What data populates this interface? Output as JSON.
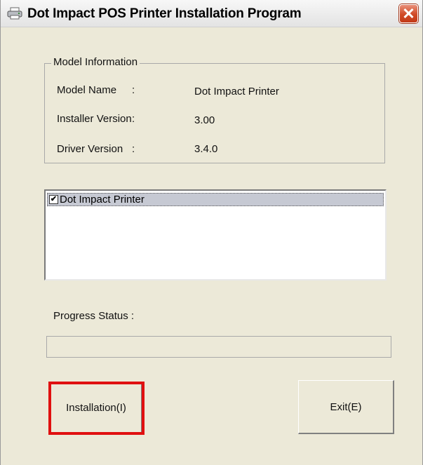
{
  "window": {
    "title": "Dot Impact POS Printer Installation Program",
    "title_icon": "printer-icon",
    "close_icon": "close-icon"
  },
  "model_info": {
    "legend": "Model Information",
    "rows": [
      {
        "label": "Model Name",
        "sep": ":",
        "value": "Dot Impact Printer"
      },
      {
        "label": "Installer Version",
        "sep": ":",
        "value": "3.00"
      },
      {
        "label": "Driver Version",
        "sep": ":",
        "value": "3.4.0"
      }
    ]
  },
  "printer_list": {
    "items": [
      {
        "label": "Dot Impact Printer",
        "checked": true
      }
    ]
  },
  "progress": {
    "label": "Progress Status :",
    "value": 0
  },
  "buttons": {
    "install_label": "Installation(I)",
    "exit_label": "Exit(E)"
  },
  "colors": {
    "window_bg": "#ece9d8",
    "highlight": "#e01010",
    "close_button": "#d04a26",
    "selection": "#c6c9d3"
  }
}
